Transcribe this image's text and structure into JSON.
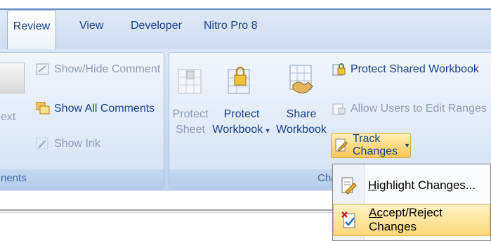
{
  "tabs": {
    "review": "Review",
    "view": "View",
    "developer": "Developer",
    "nitro": "Nitro Pro 8"
  },
  "comments_group": {
    "partial_button": "ext",
    "show_hide_comment": "Show/Hide Comment",
    "show_all_comments": "Show All Comments",
    "show_ink": "Show Ink",
    "label": "nents"
  },
  "changes_group": {
    "protect_sheet_line1": "Protect",
    "protect_sheet_line2": "Sheet",
    "protect_workbook_line1": "Protect",
    "protect_workbook_line2": "Workbook",
    "share_workbook_line1": "Share",
    "share_workbook_line2": "Workbook",
    "protect_shared_workbook": "Protect Shared Workbook",
    "allow_users_edit_ranges": "Allow Users to Edit Ranges",
    "track_changes": "Track Changes",
    "label": "Char"
  },
  "track_changes_menu": {
    "highlight_prefix": "H",
    "highlight_rest": "ighlight Changes...",
    "accept_prefix": "A",
    "accept_middle": "c",
    "accept_rest": "cept/Reject Changes"
  },
  "colors": {
    "ribbon_text": "#15428b",
    "track_changes_highlight": "#fdd87f",
    "menu_hover": "#fde49b"
  }
}
